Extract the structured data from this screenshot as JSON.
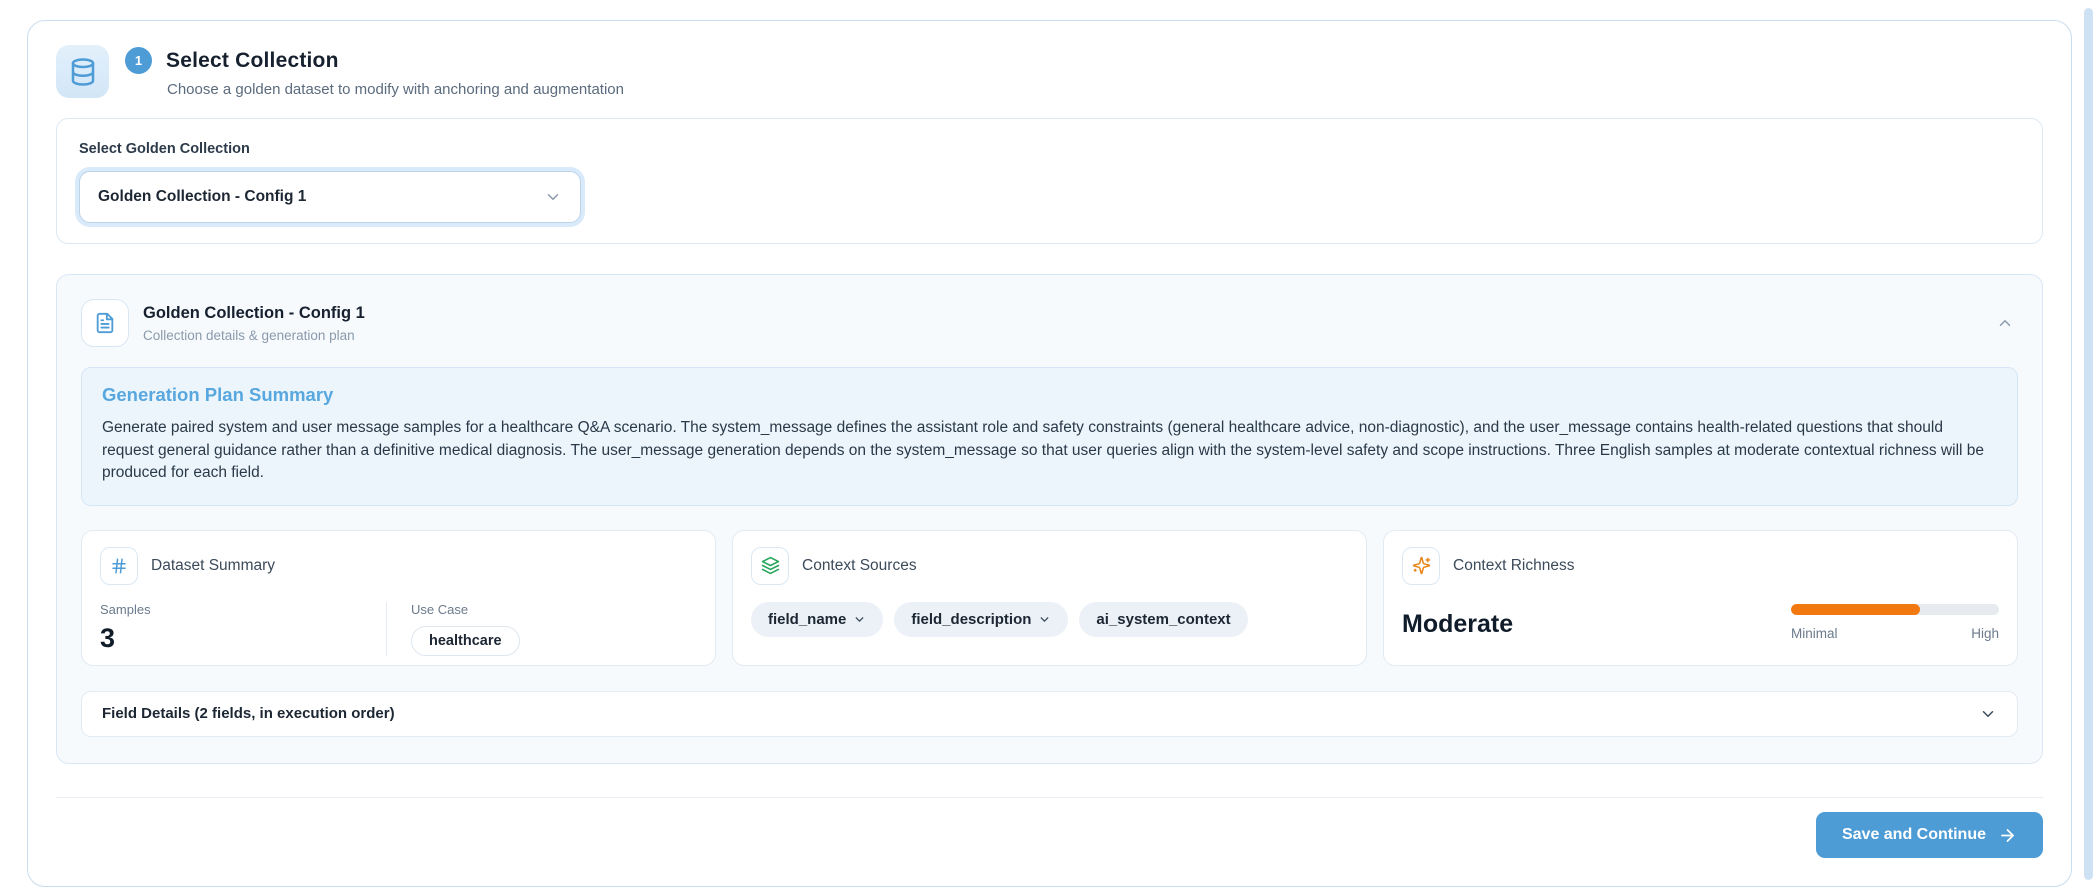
{
  "page": {
    "header": {
      "step_number": "1",
      "title": "Select Collection",
      "subtitle": "Choose a golden dataset to modify with anchoring and augmentation"
    },
    "collection_select": {
      "label": "Select Golden Collection",
      "selected_value": "Golden Collection - Config 1"
    },
    "collection_card": {
      "title": "Golden Collection - Config 1",
      "subtitle": "Collection details & generation plan",
      "plan_summary": {
        "heading": "Generation Plan Summary",
        "body": "Generate paired system and user message samples for a healthcare Q&A scenario. The system_message defines the assistant role and safety constraints (general healthcare advice, non-diagnostic), and the user_message contains health-related questions that should request general guidance rather than a definitive medical diagnosis. The user_message generation depends on the system_message so that user queries align with the system-level safety and scope instructions. Three English samples at moderate contextual richness will be produced for each field."
      },
      "dataset_summary": {
        "title": "Dataset Summary",
        "samples_label": "Samples",
        "samples_value": "3",
        "use_case_label": "Use Case",
        "use_case_value": "healthcare"
      },
      "context_sources": {
        "title": "Context Sources",
        "chips": [
          {
            "label": "field_name"
          },
          {
            "label": "field_description"
          },
          {
            "label": "ai_system_context"
          }
        ]
      },
      "context_richness": {
        "title": "Context Richness",
        "level": "Moderate",
        "progress_percent": 62,
        "scale_min_label": "Minimal",
        "scale_max_label": "High"
      },
      "field_details": {
        "label": "Field Details (2 fields, in execution order)"
      }
    },
    "footer": {
      "save_button_label": "Save and Continue"
    },
    "icons": {
      "app": "database-icon",
      "card": "file-text-icon",
      "dataset": "hash-icon",
      "sources": "layers-icon",
      "richness": "sparkles-icon"
    },
    "colors": {
      "primary_blue": "#4e9cd6",
      "summary_heading_blue": "#58a7de",
      "progress_orange": "#f2790f",
      "sources_green": "#27a55a"
    }
  }
}
